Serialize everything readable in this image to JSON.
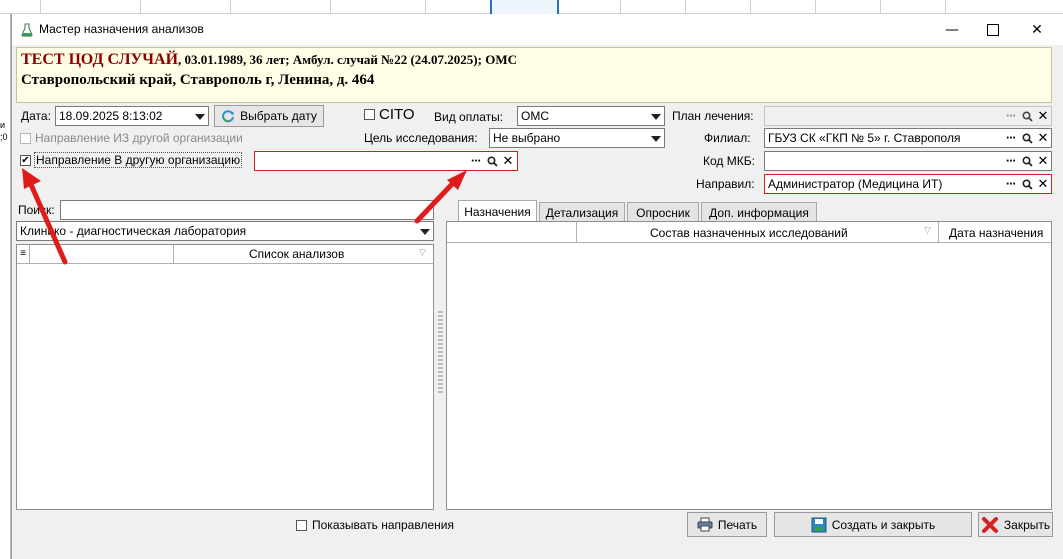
{
  "window": {
    "title": "Мастер назначения анализов"
  },
  "left_strip": {
    "text_a": "и",
    "text_b": ";0"
  },
  "patient": {
    "name": "ТЕСТ ЦОД СЛУЧАЙ",
    "details": ", 03.01.1989, 36 лет; Амбул. случай №22 (24.07.2025); ОМС",
    "address": "Ставропольский край, Ставрополь г, Ленина, д. 464"
  },
  "form": {
    "date_label": "Дата:",
    "date_value": "18.09.2025 8:13:02",
    "pick_date_button": "Выбрать дату",
    "cito_label": "CITO",
    "payment_label": "Вид оплаты:",
    "payment_value": "ОМС",
    "plan_label": "План лечения:",
    "plan_value": "",
    "from_org_label": "Направление ИЗ другой организации",
    "purpose_label": "Цель исследования:",
    "purpose_value": "Не выбрано",
    "branch_label": "Филиал:",
    "branch_value": "ГБУЗ СК «ГКП № 5» г. Ставрополя",
    "to_org_label": "Направление В другую организацию",
    "to_org_value": "",
    "mkb_label": "Код МКБ:",
    "mkb_value": "",
    "sender_label": "Направил:",
    "sender_value": "Администратор (Медицина ИТ)"
  },
  "left_panel": {
    "search_label": "Поиск:",
    "search_value": "",
    "lab_value": "Клинико - диагностическая лаборатория",
    "list_header": "Список анализов"
  },
  "tabs": [
    {
      "label": "Назначения"
    },
    {
      "label": "Детализация"
    },
    {
      "label": "Опросник"
    },
    {
      "label": "Доп. информация"
    }
  ],
  "right_panel": {
    "col_composition": "Состав назначенных исследований",
    "col_date": "Дата назначения"
  },
  "footer": {
    "show_directions": "Показывать направления",
    "print_button": "Печать",
    "create_close_button": "Создать и закрыть",
    "close_button": "Закрыть"
  },
  "colors": {
    "annotation_arrow": "#e01b1b",
    "patient_name": "#8b0000",
    "required_border": "#d11f1f"
  }
}
